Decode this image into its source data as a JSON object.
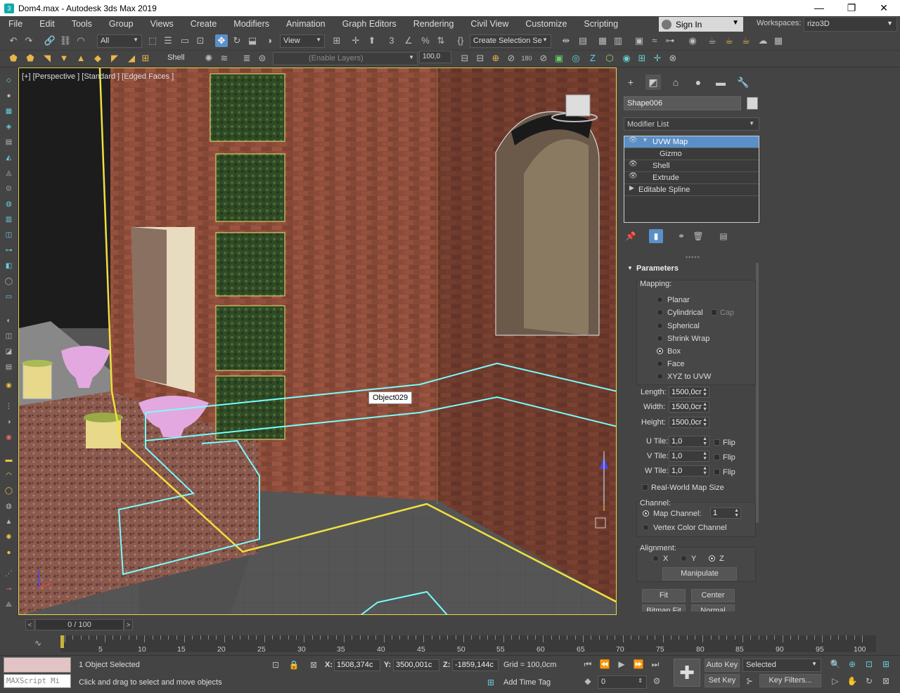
{
  "window": {
    "title": "Dom4.max - Autodesk 3ds Max 2019",
    "minimize": "—",
    "restore": "❐",
    "close": "✕"
  },
  "menu": {
    "items": [
      "File",
      "Edit",
      "Tools",
      "Group",
      "Views",
      "Create",
      "Modifiers",
      "Animation",
      "Graph Editors",
      "Rendering",
      "Civil View",
      "Customize",
      "Scripting"
    ]
  },
  "account": {
    "sign_in": "Sign In",
    "workspaces_label": "Workspaces:",
    "workspace": "rizo3D"
  },
  "toolbar": {
    "filter": "All",
    "ref_coord": "View",
    "selection_set": "Create Selection Se",
    "shell_label": "Shell",
    "layer": "(Enable Layers)",
    "layer_value": "100,0"
  },
  "viewport": {
    "label": "[+] [Perspective ] [Standard ] [Edged Faces ]",
    "tooltip": "Object029"
  },
  "command_panel": {
    "object_name": "Shape006",
    "modifier_list": "Modifier List",
    "stack": [
      {
        "label": "UVW Map",
        "selected": true,
        "eye": true,
        "expanded": true,
        "indent": false
      },
      {
        "label": "Gizmo",
        "selected": false,
        "eye": false,
        "sub": true
      },
      {
        "label": "Shell",
        "selected": false,
        "eye": true
      },
      {
        "label": "Extrude",
        "selected": false,
        "eye": true
      },
      {
        "label": "Editable Spline",
        "selected": false,
        "eye": false,
        "collapsed": true
      }
    ],
    "parameters_title": "Parameters",
    "mapping_title": "Mapping:",
    "mapping_options": [
      {
        "label": "Planar",
        "on": false
      },
      {
        "label": "Cylindrical",
        "on": false
      },
      {
        "label": "Spherical",
        "on": false
      },
      {
        "label": "Shrink Wrap",
        "on": false
      },
      {
        "label": "Box",
        "on": true
      },
      {
        "label": "Face",
        "on": false
      },
      {
        "label": "XYZ to UVW",
        "on": false
      }
    ],
    "cap_label": "Cap",
    "length_label": "Length:",
    "length": "1500,0cr",
    "width_label": "Width:",
    "width": "1500,0cr",
    "height_label": "Height:",
    "height": "1500,0cr",
    "u_tile_label": "U Tile:",
    "u_tile": "1,0",
    "v_tile_label": "V Tile:",
    "v_tile": "1,0",
    "w_tile_label": "W Tile:",
    "w_tile": "1,0",
    "flip_label": "Flip",
    "real_world": "Real-World Map Size",
    "channel_title": "Channel:",
    "map_channel_label": "Map Channel:",
    "map_channel": "1",
    "vertex_color": "Vertex Color Channel",
    "alignment_title": "Alignment:",
    "align_x": "X",
    "align_y": "Y",
    "align_z": "Z",
    "manipulate": "Manipulate",
    "fit": "Fit",
    "center": "Center",
    "bitmap_fit": "Bitmap Fit",
    "normal_align": "Normal Align"
  },
  "timeline": {
    "frame": "0 / 100",
    "ticks": [
      "5",
      "10",
      "15",
      "20",
      "25",
      "30",
      "35",
      "40",
      "45",
      "50",
      "55",
      "60",
      "65",
      "70",
      "75",
      "80",
      "85",
      "90",
      "95",
      "100"
    ]
  },
  "status": {
    "maxscript": "MAXScript Mi",
    "selection": "1 Object Selected",
    "prompt": "Click and drag to select and move objects",
    "x_label": "X:",
    "x": "1508,374c",
    "y_label": "Y:",
    "y": "3500,001c",
    "z_label": "Z:",
    "z": "-1859,144c",
    "grid": "Grid = 100,0cm",
    "add_time_tag": "Add Time Tag",
    "current_frame": "0",
    "auto_key": "Auto Key",
    "selected": "Selected",
    "set_key": "Set Key",
    "key_filters": "Key Filters..."
  }
}
